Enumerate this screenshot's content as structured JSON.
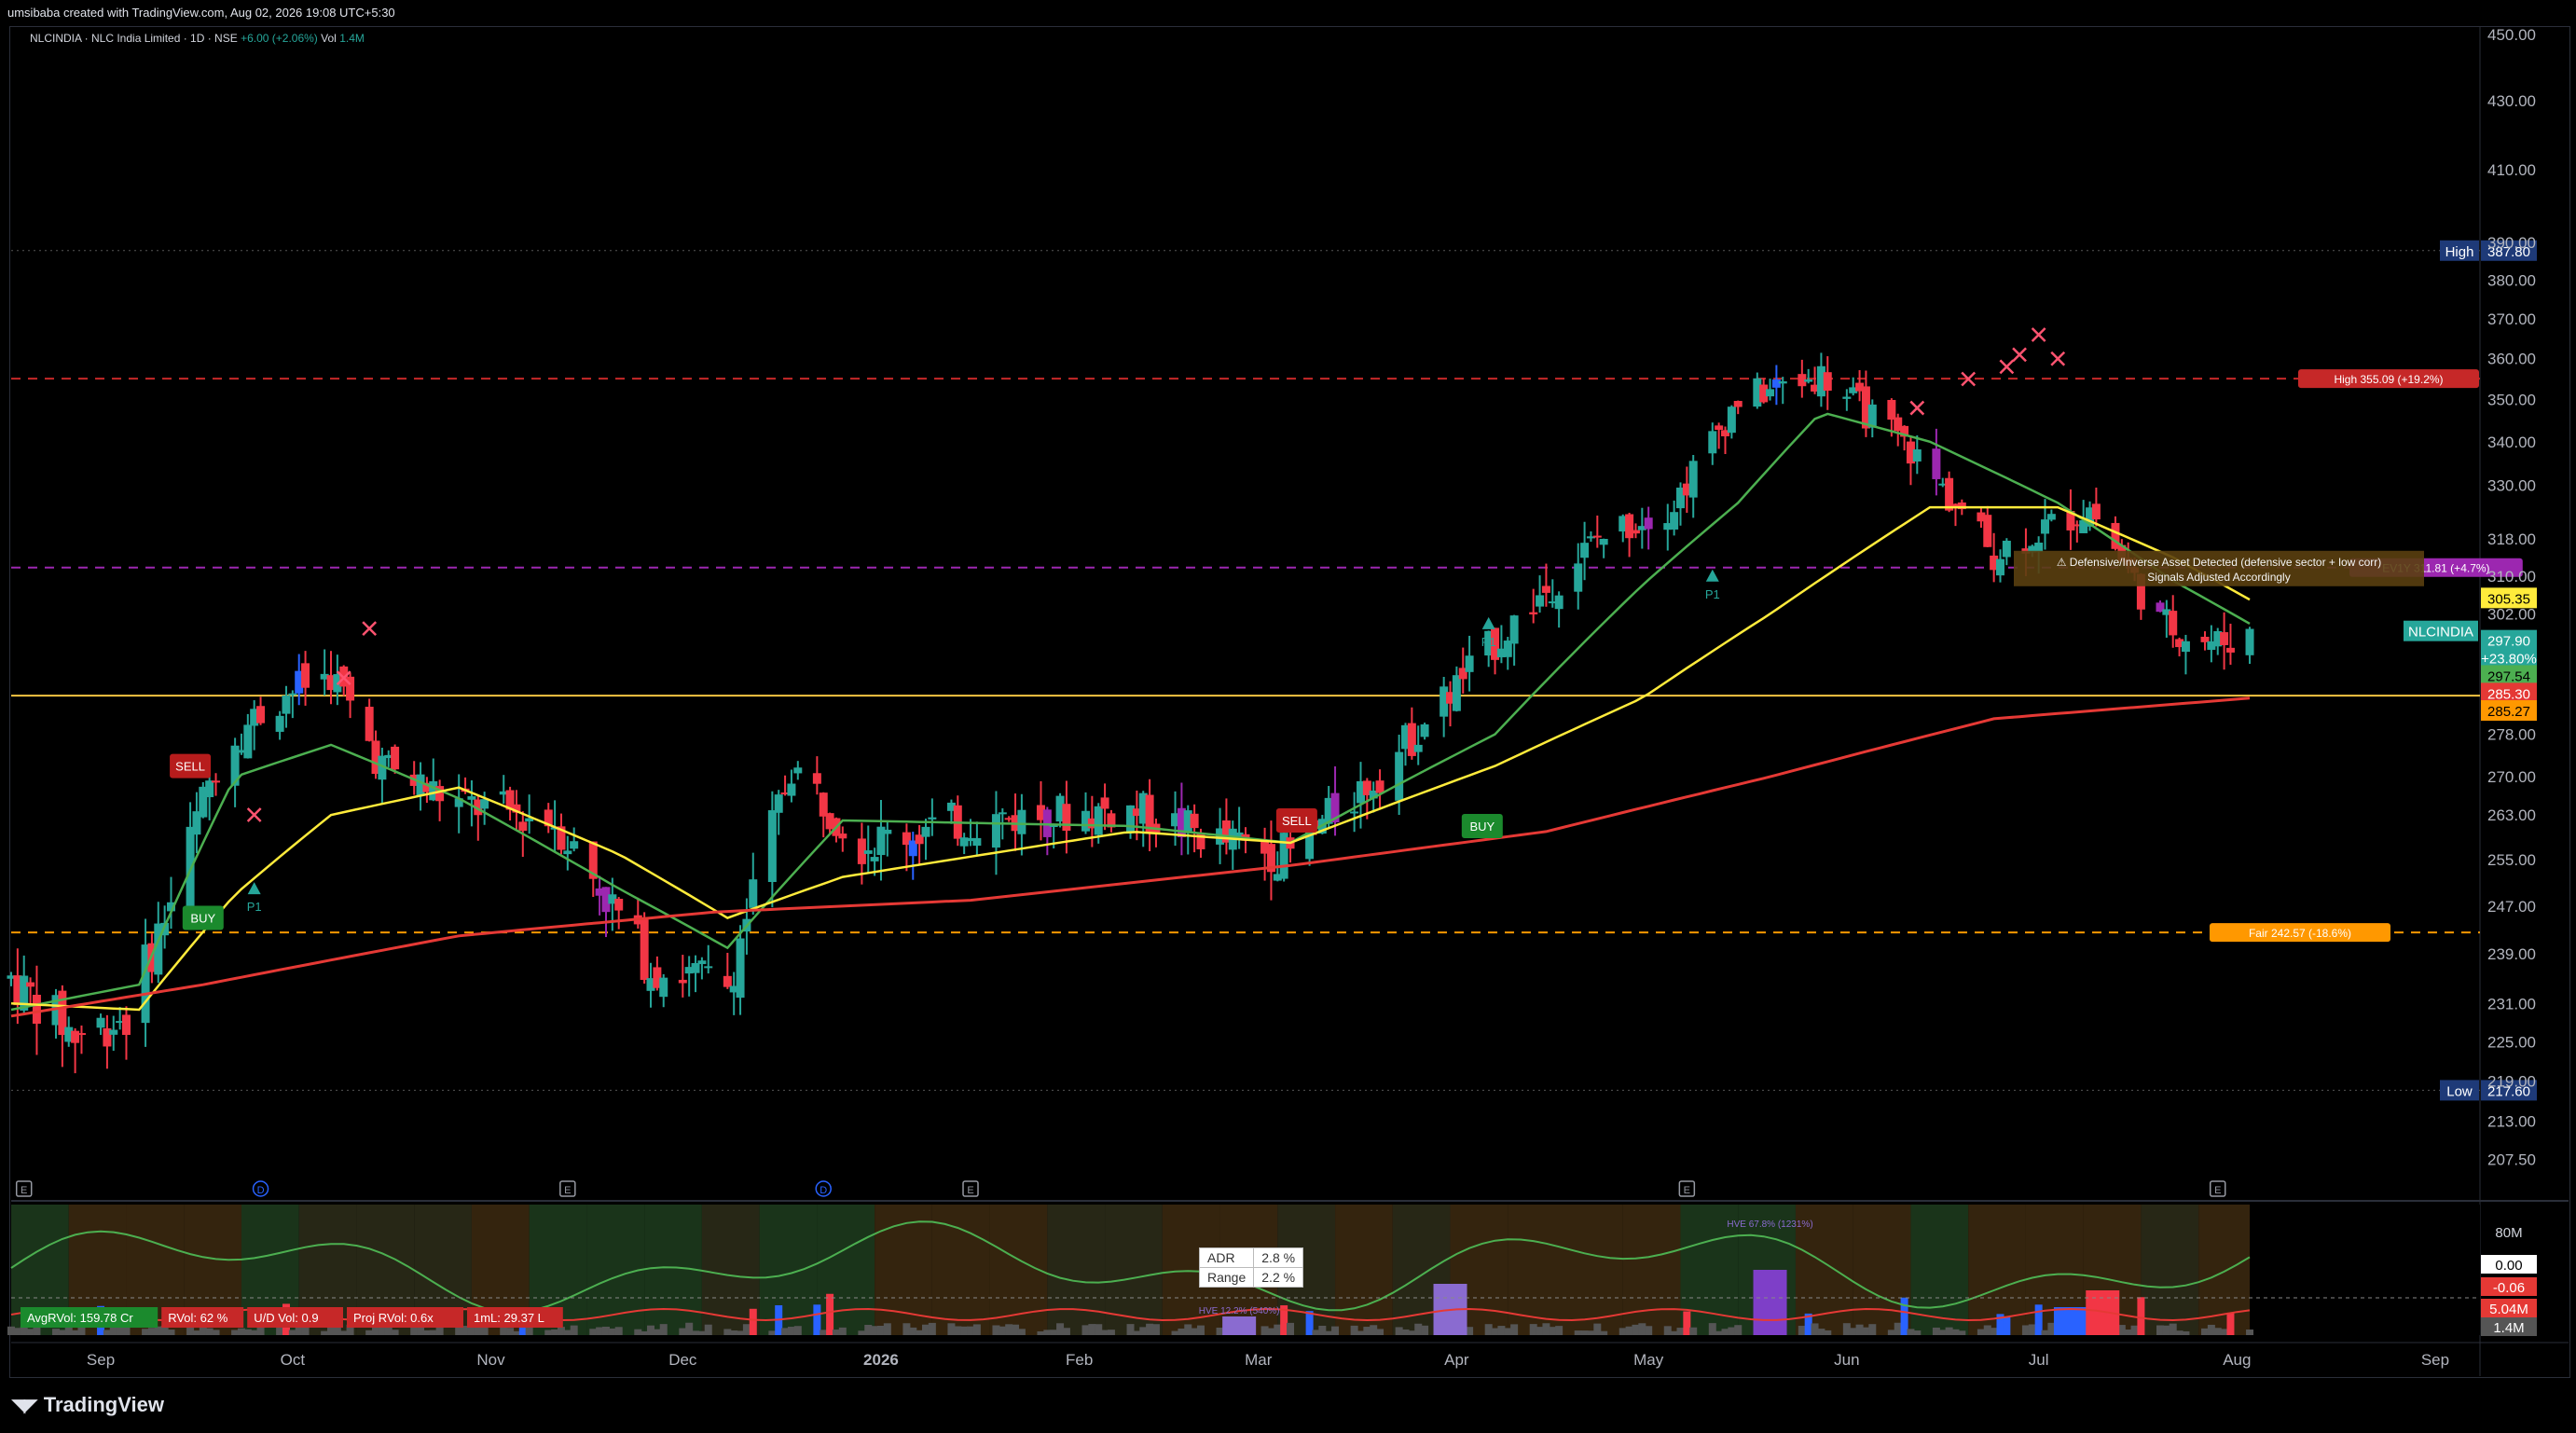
{
  "credit": "umsibaba created with TradingView.com, Aug 02, 2026 19:08 UTC+5:30",
  "symbol_info": {
    "name": "NLCINDIA · NLC India Limited · 1D · NSE",
    "change": "+6.00 (+2.06%)",
    "vol_label": "Vol",
    "vol_value": "1.4M"
  },
  "footer_brand": "TradingView",
  "colors": {
    "up": "#26a69a",
    "down": "#f23645",
    "ema_fast": "#4caf50",
    "ema_mid": "#ffeb3b",
    "ema_slow": "#e53935",
    "hline_high": "#c62828",
    "hline_ev": "#9c27b0",
    "hline_fair": "#ff9800",
    "support": "#f5c542"
  },
  "chart_data": {
    "type": "candlestick",
    "symbol": "NLCINDIA",
    "timeframe": "1D",
    "ylim": [
      204,
      452
    ],
    "y_ticks": [
      "450.00",
      "430.00",
      "410.00",
      "390.00",
      "380.00",
      "370.00",
      "360.00",
      "350.00",
      "340.00",
      "330.00",
      "318.00",
      "310.00",
      "302.00",
      "294.00",
      "286.00",
      "278.00",
      "270.00",
      "263.00",
      "255.00",
      "247.00",
      "239.00",
      "231.00",
      "225.00",
      "219.00",
      "213.00",
      "207.50"
    ],
    "x_labels": [
      "Sep",
      "Oct",
      "Nov",
      "Dec",
      "2026",
      "Feb",
      "Mar",
      "Apr",
      "May",
      "Jun",
      "Jul",
      "Aug",
      "Sep"
    ],
    "x_label_positions_days": [
      21,
      51,
      82,
      112,
      143,
      174,
      202,
      233,
      263,
      294,
      324,
      355,
      386
    ],
    "ohlc_keypoints": [
      {
        "day": 0,
        "price": 235
      },
      {
        "day": 10,
        "price": 226
      },
      {
        "day": 18,
        "price": 229
      },
      {
        "day": 25,
        "price": 248
      },
      {
        "day": 33,
        "price": 276
      },
      {
        "day": 43,
        "price": 286
      },
      {
        "day": 50,
        "price": 290
      },
      {
        "day": 58,
        "price": 272
      },
      {
        "day": 70,
        "price": 265
      },
      {
        "day": 85,
        "price": 262
      },
      {
        "day": 100,
        "price": 237
      },
      {
        "day": 112,
        "price": 234
      },
      {
        "day": 122,
        "price": 272
      },
      {
        "day": 133,
        "price": 258
      },
      {
        "day": 150,
        "price": 262
      },
      {
        "day": 175,
        "price": 264
      },
      {
        "day": 190,
        "price": 258
      },
      {
        "day": 200,
        "price": 256
      },
      {
        "day": 215,
        "price": 272
      },
      {
        "day": 232,
        "price": 296
      },
      {
        "day": 248,
        "price": 318
      },
      {
        "day": 260,
        "price": 326
      },
      {
        "day": 270,
        "price": 350
      },
      {
        "day": 283,
        "price": 356
      },
      {
        "day": 297,
        "price": 338
      },
      {
        "day": 310,
        "price": 315
      },
      {
        "day": 325,
        "price": 325
      },
      {
        "day": 336,
        "price": 300
      },
      {
        "day": 345,
        "price": 296
      },
      {
        "day": 350,
        "price": 298
      }
    ],
    "ema_fast_keypoints": [
      {
        "day": 0,
        "price": 230
      },
      {
        "day": 20,
        "price": 234
      },
      {
        "day": 35,
        "price": 270
      },
      {
        "day": 50,
        "price": 276
      },
      {
        "day": 70,
        "price": 266
      },
      {
        "day": 95,
        "price": 250
      },
      {
        "day": 112,
        "price": 240
      },
      {
        "day": 130,
        "price": 262
      },
      {
        "day": 175,
        "price": 261
      },
      {
        "day": 200,
        "price": 258
      },
      {
        "day": 232,
        "price": 278
      },
      {
        "day": 255,
        "price": 308
      },
      {
        "day": 270,
        "price": 326
      },
      {
        "day": 283,
        "price": 347
      },
      {
        "day": 300,
        "price": 340
      },
      {
        "day": 320,
        "price": 326
      },
      {
        "day": 338,
        "price": 309
      },
      {
        "day": 350,
        "price": 300
      }
    ],
    "ema_mid_keypoints": [
      {
        "day": 0,
        "price": 231
      },
      {
        "day": 20,
        "price": 230
      },
      {
        "day": 35,
        "price": 249
      },
      {
        "day": 50,
        "price": 263
      },
      {
        "day": 70,
        "price": 268
      },
      {
        "day": 95,
        "price": 256
      },
      {
        "day": 112,
        "price": 245
      },
      {
        "day": 130,
        "price": 252
      },
      {
        "day": 175,
        "price": 260
      },
      {
        "day": 200,
        "price": 258
      },
      {
        "day": 232,
        "price": 272
      },
      {
        "day": 255,
        "price": 285
      },
      {
        "day": 275,
        "price": 302
      },
      {
        "day": 300,
        "price": 325
      },
      {
        "day": 320,
        "price": 325
      },
      {
        "day": 338,
        "price": 314
      },
      {
        "day": 350,
        "price": 305
      }
    ],
    "ema_slow_keypoints": [
      {
        "day": 0,
        "price": 229
      },
      {
        "day": 30,
        "price": 234
      },
      {
        "day": 70,
        "price": 242
      },
      {
        "day": 110,
        "price": 246
      },
      {
        "day": 150,
        "price": 248
      },
      {
        "day": 200,
        "price": 254
      },
      {
        "day": 240,
        "price": 260
      },
      {
        "day": 275,
        "price": 270
      },
      {
        "day": 310,
        "price": 281
      },
      {
        "day": 350,
        "price": 285
      }
    ],
    "horizontal_levels": [
      {
        "label": "High 355.09 (+19.2%)",
        "price": 355.09,
        "color": "#c62828"
      },
      {
        "label": "EV1Y 311.81 (+4.7%)",
        "price": 311.81,
        "color": "#9c27b0"
      },
      {
        "label": "Fair 242.57 (-18.6%)",
        "price": 242.57,
        "color": "#ff9800"
      }
    ],
    "support_line_price": 285.5,
    "high_marker": {
      "label": "High",
      "value": "387.80",
      "price": 387.8
    },
    "low_marker": {
      "label": "Low",
      "value": "217.60",
      "price": 217.6
    },
    "price_tags": [
      {
        "value": "305.35",
        "bg": "#ffeb3b",
        "fg": "#000",
        "price": 305.35
      },
      {
        "value": "NLCINDIA",
        "bg": "#26a69a",
        "fg": "#fff",
        "price": 298.5,
        "wide": true
      },
      {
        "value": "297.90",
        "bg": "#26a69a",
        "fg": "#fff",
        "price": 296.6
      },
      {
        "value": "+23.80%",
        "bg": "#26a69a",
        "fg": "#fff",
        "price": 293.0
      },
      {
        "value": "297.54",
        "bg": "#4caf50",
        "fg": "#000",
        "price": 289.5
      },
      {
        "value": "285.30",
        "bg": "#e53935",
        "fg": "#fff",
        "price": 286.0
      },
      {
        "value": "285.27",
        "bg": "#ff9800",
        "fg": "#000",
        "price": 282.6
      }
    ],
    "signals": [
      {
        "text": "SELL",
        "day": 28,
        "price": 272,
        "bg": "#b71c1c"
      },
      {
        "text": "BUY",
        "day": 30,
        "price": 245,
        "bg": "#1b8a2d"
      },
      {
        "text": "SELL",
        "day": 201,
        "price": 262,
        "bg": "#b71c1c"
      },
      {
        "text": "BUY",
        "day": 230,
        "price": 261,
        "bg": "#1b8a2d"
      }
    ],
    "annotation_banner": {
      "line1": "⚠ Defensive/Inverse Asset Detected (defensive sector + low corr)",
      "line2": "Signals Adjusted Accordingly"
    },
    "p1_labels": [
      "P1",
      "P1",
      "P1"
    ],
    "event_labels": [
      "E",
      "D",
      "E",
      "D",
      "E",
      "E",
      "E"
    ],
    "indicator_pane": {
      "right_ticks": [
        {
          "value": "80M",
          "bg": "none",
          "fg": "#d1d4dc"
        },
        {
          "value": "0.00",
          "bg": "#ffffff",
          "fg": "#000"
        },
        {
          "value": "-0.06",
          "bg": "#e53935",
          "fg": "#fff"
        },
        {
          "value": "5.04M",
          "bg": "#e53935",
          "fg": "#fff"
        },
        {
          "value": "1.4M",
          "bg": "#555",
          "fg": "#fff"
        }
      ],
      "stats": [
        {
          "text": "AvgRVol: 159.78 Cr",
          "bg": "#1b8a2d"
        },
        {
          "text": "RVol: 62 %",
          "bg": "#c62828"
        },
        {
          "text": "U/D Vol: 0.9",
          "bg": "#c62828"
        },
        {
          "text": "Proj RVol: 0.6x",
          "bg": "#c62828"
        },
        {
          "text": "1mL: 29.37 L",
          "bg": "#c62828"
        }
      ],
      "adr_table": [
        [
          "ADR",
          "2.8 %"
        ],
        [
          "Range",
          "2.2 %"
        ]
      ],
      "hve_labels": [
        "HVE 12.2% (540%)",
        "HVE 67.8% (1231%)"
      ]
    }
  }
}
